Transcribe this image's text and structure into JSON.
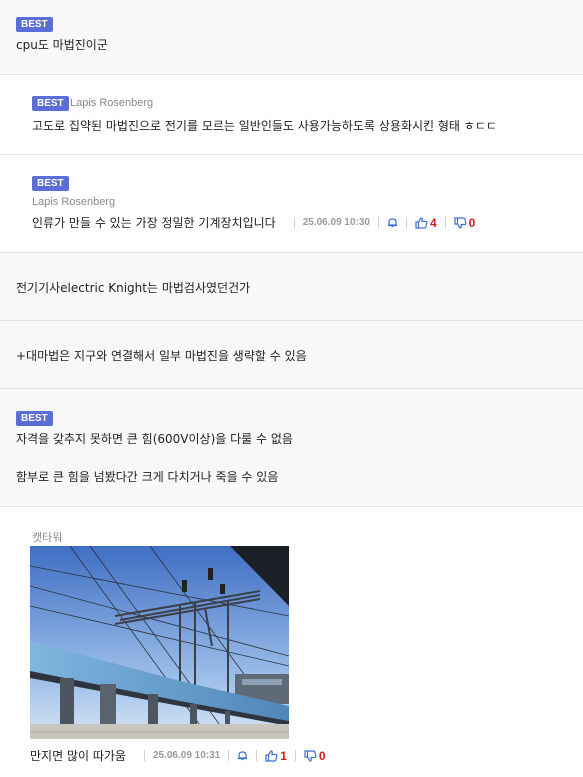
{
  "comments": [
    {
      "badge": "BEST",
      "text": "cpu도 마법진이군"
    },
    {
      "badge": "BEST",
      "author": "Lapis Rosenberg",
      "text": "고도로 집약된 마법진으로 전기를 모르는 일반인들도 사용가능하도록 상용화시킨 형태 ㅎㄷㄷ"
    },
    {
      "badge": "BEST",
      "author": "Lapis Rosenberg",
      "text": "인류가 만들 수 있는 가장 정밀한 기계장치입니다",
      "date": "25.06.09 10:30",
      "likes": "4",
      "dislikes": "0"
    },
    {
      "text": "전기기사electric Knight는 마법검사였던건가"
    },
    {
      "text": "+대마법은 지구와 연결해서 일부 마법진을 생략할 수 있음"
    },
    {
      "badge": "BEST",
      "line1": "자격을 갖추지 못하면 큰 힘(600V이상)을 다룰 수 없음",
      "line2": "함부로 큰 힘을 넘봤다간 크게 다치거나 죽을 수 있음"
    },
    {
      "author": "캣타워",
      "text": "만지면 많이 따가움",
      "date": "25.06.09 10:31",
      "likes": "1",
      "dislikes": "0"
    }
  ],
  "icons": {
    "alert": "bell-icon",
    "like": "thumbs-up-icon",
    "dislike": "thumbs-down-icon"
  },
  "colors": {
    "badge": "#5a6fd6",
    "vote": "#d21c1c",
    "thumb": "#3b6fd0"
  }
}
